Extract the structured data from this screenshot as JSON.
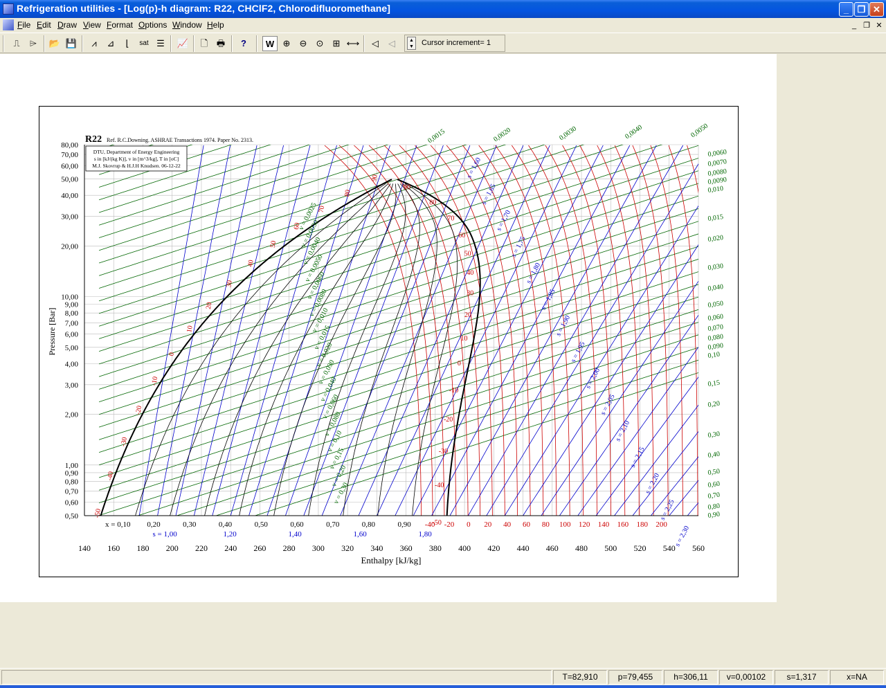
{
  "window": {
    "title": "Refrigeration utilities - [Log(p)-h diagram: R22, CHClF2, Chlorodifluoromethane]",
    "minimize": "_",
    "restore": "❐",
    "close": "✕"
  },
  "menu": {
    "items": [
      "File",
      "Edit",
      "Draw",
      "View",
      "Format",
      "Options",
      "Window",
      "Help"
    ]
  },
  "toolbar": {
    "cursor_increment_label": "Cursor increment= 1"
  },
  "status": {
    "T": "T=82,910",
    "p": "p=79,455",
    "h": "h=306,11",
    "v": "v=0,00102",
    "s": "s=1,317",
    "x": "x=NA"
  },
  "chart_data": {
    "type": "line",
    "title": "R22",
    "reference": "Ref. R.C.Downing. ASHRAE Transactions 1974. Paper No. 2313.",
    "info_box": [
      "DTU, Department of Energy Engineering",
      "s in [kJ/(kg K)], v in [m^3/kg], T in [oC]",
      "M.J. Skovrup & H.J.H Knudsen. 06-12-22"
    ],
    "xlabel": "Enthalpy [kJ/kg]",
    "ylabel": "Pressure [Bar]",
    "xlim": [
      140,
      560
    ],
    "ylim": [
      0.5,
      80
    ],
    "log_y": true,
    "grid": true,
    "x_ticks": [
      "140",
      "160",
      "180",
      "200",
      "220",
      "240",
      "260",
      "280",
      "300",
      "320",
      "340",
      "360",
      "380",
      "400",
      "420",
      "440",
      "460",
      "480",
      "500",
      "520",
      "540",
      "560"
    ],
    "y_ticks": [
      {
        "v": 80,
        "t": "80,00"
      },
      {
        "v": 70,
        "t": "70,00"
      },
      {
        "v": 60,
        "t": "60,00"
      },
      {
        "v": 50,
        "t": "50,00"
      },
      {
        "v": 40,
        "t": "40,00"
      },
      {
        "v": 30,
        "t": "30,00"
      },
      {
        "v": 20,
        "t": "20,00"
      },
      {
        "v": 10,
        "t": "10,00"
      },
      {
        "v": 9,
        "t": "9,00"
      },
      {
        "v": 8,
        "t": "8,00"
      },
      {
        "v": 7,
        "t": "7,00"
      },
      {
        "v": 6,
        "t": "6,00"
      },
      {
        "v": 5,
        "t": "5,00"
      },
      {
        "v": 4,
        "t": "4,00"
      },
      {
        "v": 3,
        "t": "3,00"
      },
      {
        "v": 2,
        "t": "2,00"
      },
      {
        "v": 1,
        "t": "1,00"
      },
      {
        "v": 0.9,
        "t": "0,90"
      },
      {
        "v": 0.8,
        "t": "0,80"
      },
      {
        "v": 0.7,
        "t": "0,70"
      },
      {
        "v": 0.6,
        "t": "0,60"
      },
      {
        "v": 0.5,
        "t": "0,50"
      }
    ],
    "quality_labels": [
      "x = 0,10",
      "0,20",
      "0,30",
      "0,40",
      "0,50",
      "0,60",
      "0,70",
      "0,80",
      "0,90"
    ],
    "entropy_bottom_labels": [
      "s = 1,00",
      "1,20",
      "1,40",
      "1,60",
      "1,80"
    ],
    "temp_bottom_labels": [
      "-40",
      "-20",
      "0",
      "20",
      "40",
      "60",
      "80",
      "100",
      "120",
      "140",
      "160",
      "180",
      "200"
    ],
    "sat_liquid_temp_labels": [
      "-50",
      "-40",
      "-30",
      "-20",
      "-10",
      "0",
      "10",
      "20",
      "30",
      "40",
      "50",
      "60",
      "70",
      "80",
      "90"
    ],
    "sat_vapor_temp_labels": [
      "-50",
      "-40",
      "-30",
      "-20",
      "-10",
      "0",
      "10",
      "20",
      "30",
      "40",
      "50",
      "60",
      "70",
      "80",
      "90"
    ],
    "entropy_labels": [
      "s = 1,60",
      "s = 1,65",
      "s = 1,70",
      "s = 1,75",
      "s = 1,80",
      "s = 1,85",
      "s = 1,90",
      "s = 1,95",
      "s = 2,00",
      "s = 2,05",
      "s = 2,10",
      "s = 2,15",
      "s = 2,20",
      "s = 2,25",
      "s = 2,30"
    ],
    "volume_labels_left": [
      "v = 0,0025",
      "v = 0,0030",
      "v = 0,0040",
      "v = 0,0050",
      "v = 0,0060",
      "v = 0,0080",
      "v = 0,010",
      "v = 0,015",
      "v = 0,020",
      "v = 0,030",
      "v = 0,040",
      "v = 0,060",
      "v = 0,080",
      "v = 0,10",
      "v = 0,15",
      "v = 0,20",
      "v = 0,30"
    ],
    "volume_labels_top": [
      "0,0015",
      "0,0020",
      "0,0030",
      "0,0040",
      "0,0050"
    ],
    "volume_labels_right": [
      "0,0060",
      "0,0070",
      "0,0080",
      "0,0090",
      "0,010",
      "0,015",
      "0,020",
      "0,030",
      "0,040",
      "0,050",
      "0,060",
      "0,070",
      "0,080",
      "0,090",
      "0,10",
      "0,15",
      "0,20",
      "0,30",
      "0,40",
      "0,50",
      "0,60",
      "0,70",
      "0,80",
      "0,90"
    ],
    "colors": {
      "saturation": "#000000",
      "isotherm": "#cc0000",
      "isentrope": "#0000cc",
      "isochore": "#006600",
      "quality": "#000000",
      "grid": "#bbbbbb"
    }
  }
}
